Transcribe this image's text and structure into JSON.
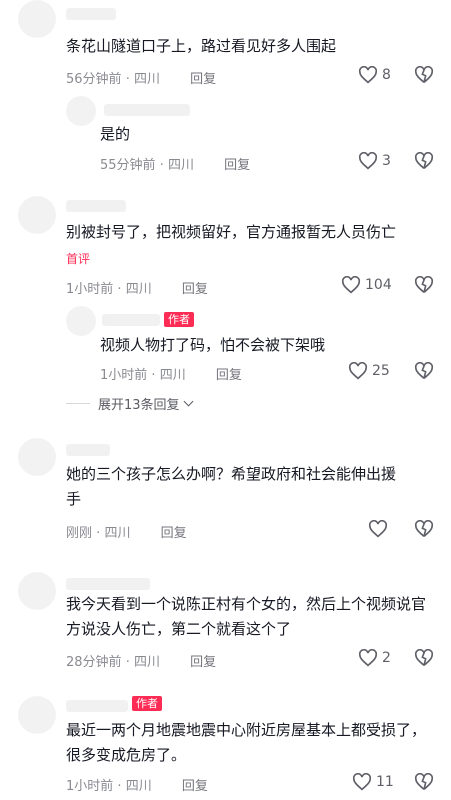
{
  "comments": [
    {
      "text": "条花山隧道口子上，路过看见好多人围起",
      "time": "56分钟前",
      "location": "四川",
      "reply": "回复",
      "likes": "8"
    },
    {
      "text": "是的",
      "time": "55分钟前",
      "location": "四川",
      "reply": "回复",
      "likes": "3"
    },
    {
      "text": "别被封号了，把视频留好，官方通报暂无人员伤亡",
      "tag": "首评",
      "time": "1小时前",
      "location": "四川",
      "reply": "回复",
      "likes": "104"
    },
    {
      "text": "视频人物打了码，怕不会被下架哦",
      "author_tag": "作者",
      "time": "1小时前",
      "location": "四川",
      "reply": "回复",
      "likes": "25"
    },
    {
      "text": "她的三个孩子怎么办啊？希望政府和社会能伸出援手",
      "time": "刚刚",
      "location": "四川",
      "reply": "回复",
      "likes": ""
    },
    {
      "text": "我今天看到一个说陈正村有个女的，然后上个视频说官方说没人伤亡，第二个就看这个了",
      "time": "28分钟前",
      "location": "四川",
      "reply": "回复",
      "likes": "2"
    },
    {
      "text": "最近一两个月地震地震中心附近房屋基本上都受损了，很多变成危房了。",
      "author_tag": "作者",
      "time": "1小时前",
      "location": "四川",
      "reply": "回复",
      "likes": "11"
    }
  ],
  "expand_label": "展开13条回复",
  "separator": "·",
  "colors": {
    "accent": "#fe2c55",
    "text": "#161823",
    "meta": "#8a8b91"
  },
  "icons": {
    "like": "heart-outline-icon",
    "dislike": "broken-heart-icon",
    "expand": "chevron-down-icon"
  }
}
